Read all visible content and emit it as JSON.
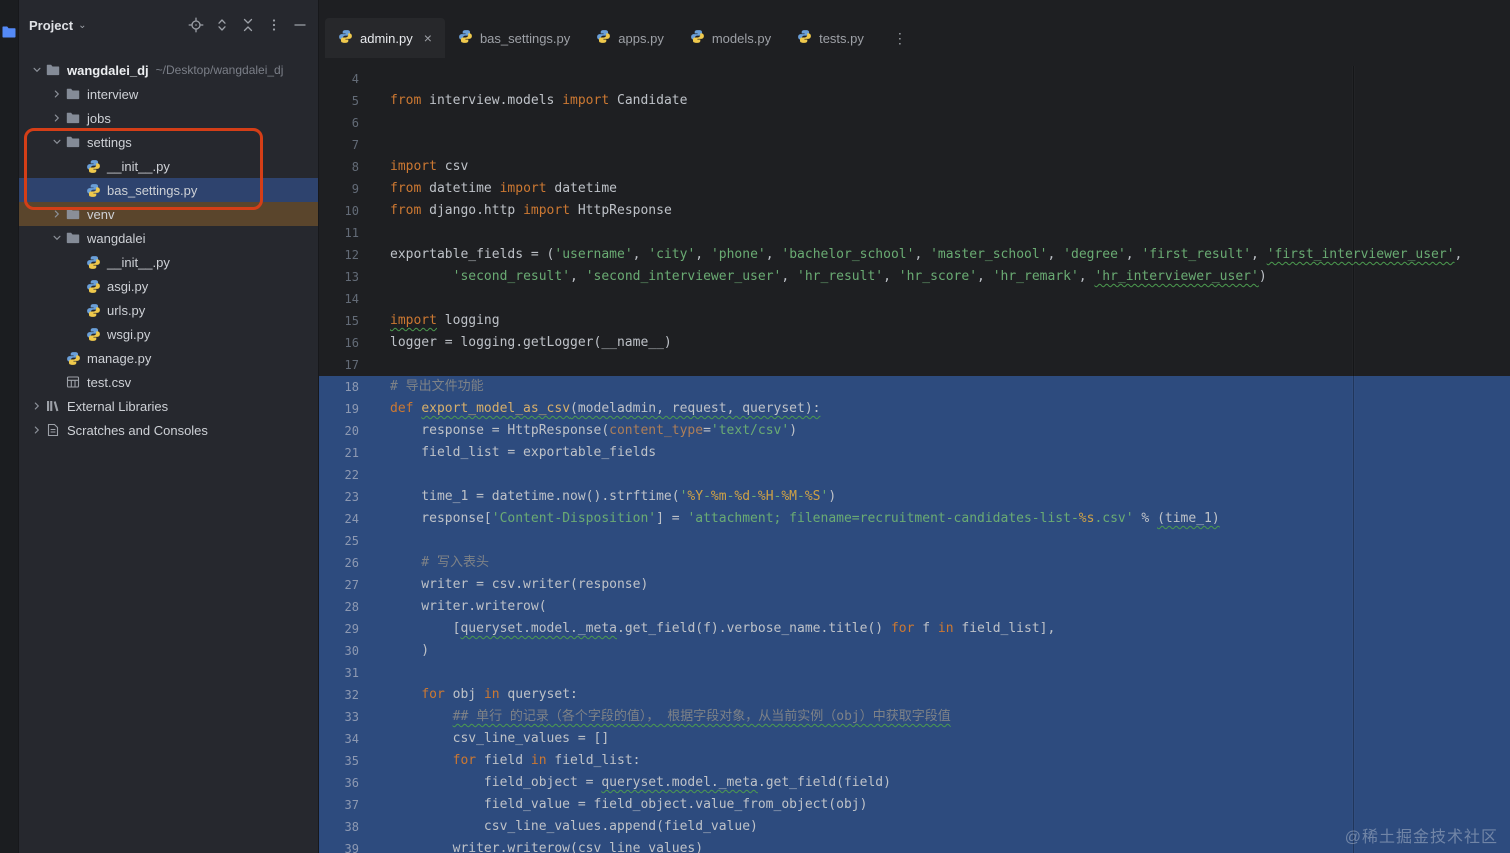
{
  "watermark": "@稀土掘金技术社区",
  "accent_colors": {
    "selection_blue": "#2d4b7e",
    "tree_selection_blue": "#2e436e",
    "excluded_brown": "#5a452c",
    "annotation_red": "#d43e17"
  },
  "toolstripe": {
    "icons": [
      "project-toolwindow-icon"
    ]
  },
  "sidebar": {
    "header": {
      "title": "Project",
      "chevron": "down",
      "icons": [
        "locate-icon",
        "expand-collapse-icon",
        "collapse-all-icon",
        "more-options-icon",
        "hide-panel-icon"
      ]
    },
    "tree": [
      {
        "label": "wangdalei_dj",
        "secondary": "~/Desktop/wangdalei_dj",
        "level": 0,
        "icon": "folder",
        "chevron": "down",
        "root": true
      },
      {
        "label": "interview",
        "level": 1,
        "icon": "folder",
        "chevron": "right"
      },
      {
        "label": "jobs",
        "level": 1,
        "icon": "folder",
        "chevron": "right"
      },
      {
        "label": "settings",
        "level": 1,
        "icon": "folder",
        "chevron": "down"
      },
      {
        "label": "__init__.py",
        "level": 2,
        "icon": "python"
      },
      {
        "label": "bas_settings.py",
        "level": 2,
        "icon": "python",
        "highlight": "selected"
      },
      {
        "label": "venv",
        "level": 1,
        "icon": "folder",
        "chevron": "right",
        "highlight": "excluded"
      },
      {
        "label": "wangdalei",
        "level": 1,
        "icon": "folder",
        "chevron": "down"
      },
      {
        "label": "__init__.py",
        "level": 2,
        "icon": "python"
      },
      {
        "label": "asgi.py",
        "level": 2,
        "icon": "python"
      },
      {
        "label": "urls.py",
        "level": 2,
        "icon": "python"
      },
      {
        "label": "wsgi.py",
        "level": 2,
        "icon": "python"
      },
      {
        "label": "manage.py",
        "level": 1,
        "icon": "python"
      },
      {
        "label": "test.csv",
        "level": 1,
        "icon": "csv"
      },
      {
        "label": "External Libraries",
        "level": 0,
        "icon": "library",
        "chevron": "right"
      },
      {
        "label": "Scratches and Consoles",
        "level": 0,
        "icon": "scratch",
        "chevron": "right"
      }
    ]
  },
  "tabs": [
    {
      "label": "admin.py",
      "active": true,
      "closable": true
    },
    {
      "label": "bas_settings.py",
      "active": false
    },
    {
      "label": "apps.py",
      "active": false
    },
    {
      "label": "models.py",
      "active": false
    },
    {
      "label": "tests.py",
      "active": false
    }
  ],
  "editor": {
    "selection": {
      "start": 18,
      "end": 39
    },
    "lines": [
      {
        "n": 4,
        "s": []
      },
      {
        "n": 5,
        "s": [
          [
            "k",
            "from"
          ],
          [
            "n",
            " interview.models "
          ],
          [
            "k",
            "import"
          ],
          [
            "n",
            " Candidate"
          ]
        ]
      },
      {
        "n": 6,
        "s": []
      },
      {
        "n": 7,
        "s": []
      },
      {
        "n": 8,
        "s": [
          [
            "k",
            "import"
          ],
          [
            "n",
            " csv"
          ]
        ]
      },
      {
        "n": 9,
        "s": [
          [
            "k",
            "from"
          ],
          [
            "n",
            " datetime "
          ],
          [
            "k",
            "import"
          ],
          [
            "n",
            " datetime"
          ]
        ]
      },
      {
        "n": 10,
        "s": [
          [
            "k",
            "from"
          ],
          [
            "n",
            " django.http "
          ],
          [
            "k",
            "import"
          ],
          [
            "n",
            " HttpResponse"
          ]
        ]
      },
      {
        "n": 11,
        "s": []
      },
      {
        "n": 12,
        "s": [
          [
            "n",
            "exportable_fields = ("
          ],
          [
            "s",
            "'username'"
          ],
          [
            "n",
            ", "
          ],
          [
            "s",
            "'city'"
          ],
          [
            "n",
            ", "
          ],
          [
            "s",
            "'phone'"
          ],
          [
            "n",
            ", "
          ],
          [
            "s",
            "'bachelor_school'"
          ],
          [
            "n",
            ", "
          ],
          [
            "s",
            "'master_school'"
          ],
          [
            "n",
            ", "
          ],
          [
            "s",
            "'degree'"
          ],
          [
            "n",
            ", "
          ],
          [
            "s",
            "'first_result'"
          ],
          [
            "n",
            ", "
          ],
          [
            "s",
            "'first_interviewer_user'",
            1
          ],
          [
            "n",
            ","
          ]
        ]
      },
      {
        "n": 13,
        "s": [
          [
            "n",
            "        "
          ],
          [
            "s",
            "'second_result'"
          ],
          [
            "n",
            ", "
          ],
          [
            "s",
            "'second_interviewer_user'"
          ],
          [
            "n",
            ", "
          ],
          [
            "s",
            "'hr_result'"
          ],
          [
            "n",
            ", "
          ],
          [
            "s",
            "'hr_score'"
          ],
          [
            "n",
            ", "
          ],
          [
            "s",
            "'hr_remark'"
          ],
          [
            "n",
            ", "
          ],
          [
            "s",
            "'hr_interviewer_user'",
            1
          ],
          [
            "n",
            ")"
          ]
        ]
      },
      {
        "n": 14,
        "s": []
      },
      {
        "n": 15,
        "s": [
          [
            "k",
            "import",
            1
          ],
          [
            "n",
            " logging"
          ]
        ]
      },
      {
        "n": 16,
        "s": [
          [
            "n",
            "logger = logging.getLogger(__name__)"
          ]
        ]
      },
      {
        "n": 17,
        "s": []
      },
      {
        "n": 18,
        "s": [
          [
            "c",
            "# 导出文件功能"
          ]
        ]
      },
      {
        "n": 19,
        "s": [
          [
            "k",
            "def "
          ],
          [
            "f",
            "export_model_as_csv",
            1
          ],
          [
            "n",
            "(modeladmin, request, queryset):",
            1
          ]
        ]
      },
      {
        "n": 20,
        "s": [
          [
            "n",
            "    response = HttpResponse("
          ],
          [
            "a",
            "content_type"
          ],
          [
            "n",
            "="
          ],
          [
            "s",
            "'text/csv'"
          ],
          [
            "n",
            ")"
          ]
        ]
      },
      {
        "n": 21,
        "s": [
          [
            "n",
            "    field_list = exportable_fields"
          ]
        ]
      },
      {
        "n": 22,
        "s": []
      },
      {
        "n": 23,
        "s": [
          [
            "n",
            "    time_1 = datetime.now().strftime("
          ],
          [
            "s",
            "'"
          ],
          [
            "m",
            "%Y"
          ],
          [
            "s",
            "-"
          ],
          [
            "m",
            "%m"
          ],
          [
            "s",
            "-"
          ],
          [
            "m",
            "%d"
          ],
          [
            "s",
            "-"
          ],
          [
            "m",
            "%H"
          ],
          [
            "s",
            "-"
          ],
          [
            "m",
            "%M"
          ],
          [
            "s",
            "-"
          ],
          [
            "m",
            "%S"
          ],
          [
            "s",
            "'"
          ],
          [
            "n",
            ")"
          ]
        ]
      },
      {
        "n": 24,
        "s": [
          [
            "n",
            "    response["
          ],
          [
            "s",
            "'Content-Disposition'"
          ],
          [
            "n",
            "] = "
          ],
          [
            "s",
            "'attachment; filename=recruitment-candidates-list-"
          ],
          [
            "m",
            "%s"
          ],
          [
            "s",
            ".csv'"
          ],
          [
            "n",
            " % "
          ],
          [
            "n",
            "(time_1)",
            1
          ]
        ]
      },
      {
        "n": 25,
        "s": []
      },
      {
        "n": 26,
        "s": [
          [
            "c",
            "    # 写入表头"
          ]
        ]
      },
      {
        "n": 27,
        "s": [
          [
            "n",
            "    writer = csv.writer(response)"
          ]
        ]
      },
      {
        "n": 28,
        "s": [
          [
            "n",
            "    writer.writerow("
          ]
        ]
      },
      {
        "n": 29,
        "s": [
          [
            "n",
            "        ["
          ],
          [
            "n",
            "queryset.model._meta",
            1
          ],
          [
            "n",
            ".get_field(f).verbose_name.title() "
          ],
          [
            "k",
            "for"
          ],
          [
            "n",
            " f "
          ],
          [
            "k",
            "in"
          ],
          [
            "n",
            " field_list],"
          ]
        ]
      },
      {
        "n": 30,
        "s": [
          [
            "n",
            "    )"
          ]
        ]
      },
      {
        "n": 31,
        "s": []
      },
      {
        "n": 32,
        "s": [
          [
            "n",
            "    "
          ],
          [
            "k",
            "for"
          ],
          [
            "n",
            " obj "
          ],
          [
            "k",
            "in"
          ],
          [
            "n",
            " queryset:"
          ]
        ]
      },
      {
        "n": 33,
        "s": [
          [
            "c",
            "        "
          ],
          [
            "c",
            "## 单行 的记录（各个字段的值）， 根据字段对象，从当前实例（obj）中获取字段值",
            1
          ]
        ]
      },
      {
        "n": 34,
        "s": [
          [
            "n",
            "        csv_line_values = []"
          ]
        ]
      },
      {
        "n": 35,
        "s": [
          [
            "n",
            "        "
          ],
          [
            "k",
            "for"
          ],
          [
            "n",
            " field "
          ],
          [
            "k",
            "in"
          ],
          [
            "n",
            " field_list:"
          ]
        ]
      },
      {
        "n": 36,
        "s": [
          [
            "n",
            "            field_object = "
          ],
          [
            "n",
            "queryset.model._meta",
            1
          ],
          [
            "n",
            ".get_field(field)"
          ]
        ]
      },
      {
        "n": 37,
        "s": [
          [
            "n",
            "            field_value = field_object.value_from_object(obj)"
          ]
        ]
      },
      {
        "n": 38,
        "s": [
          [
            "n",
            "            csv_line_values.append(field_value)"
          ]
        ]
      },
      {
        "n": 39,
        "s": [
          [
            "n",
            "        writer.writerow(csv_line_values)"
          ]
        ]
      }
    ]
  }
}
